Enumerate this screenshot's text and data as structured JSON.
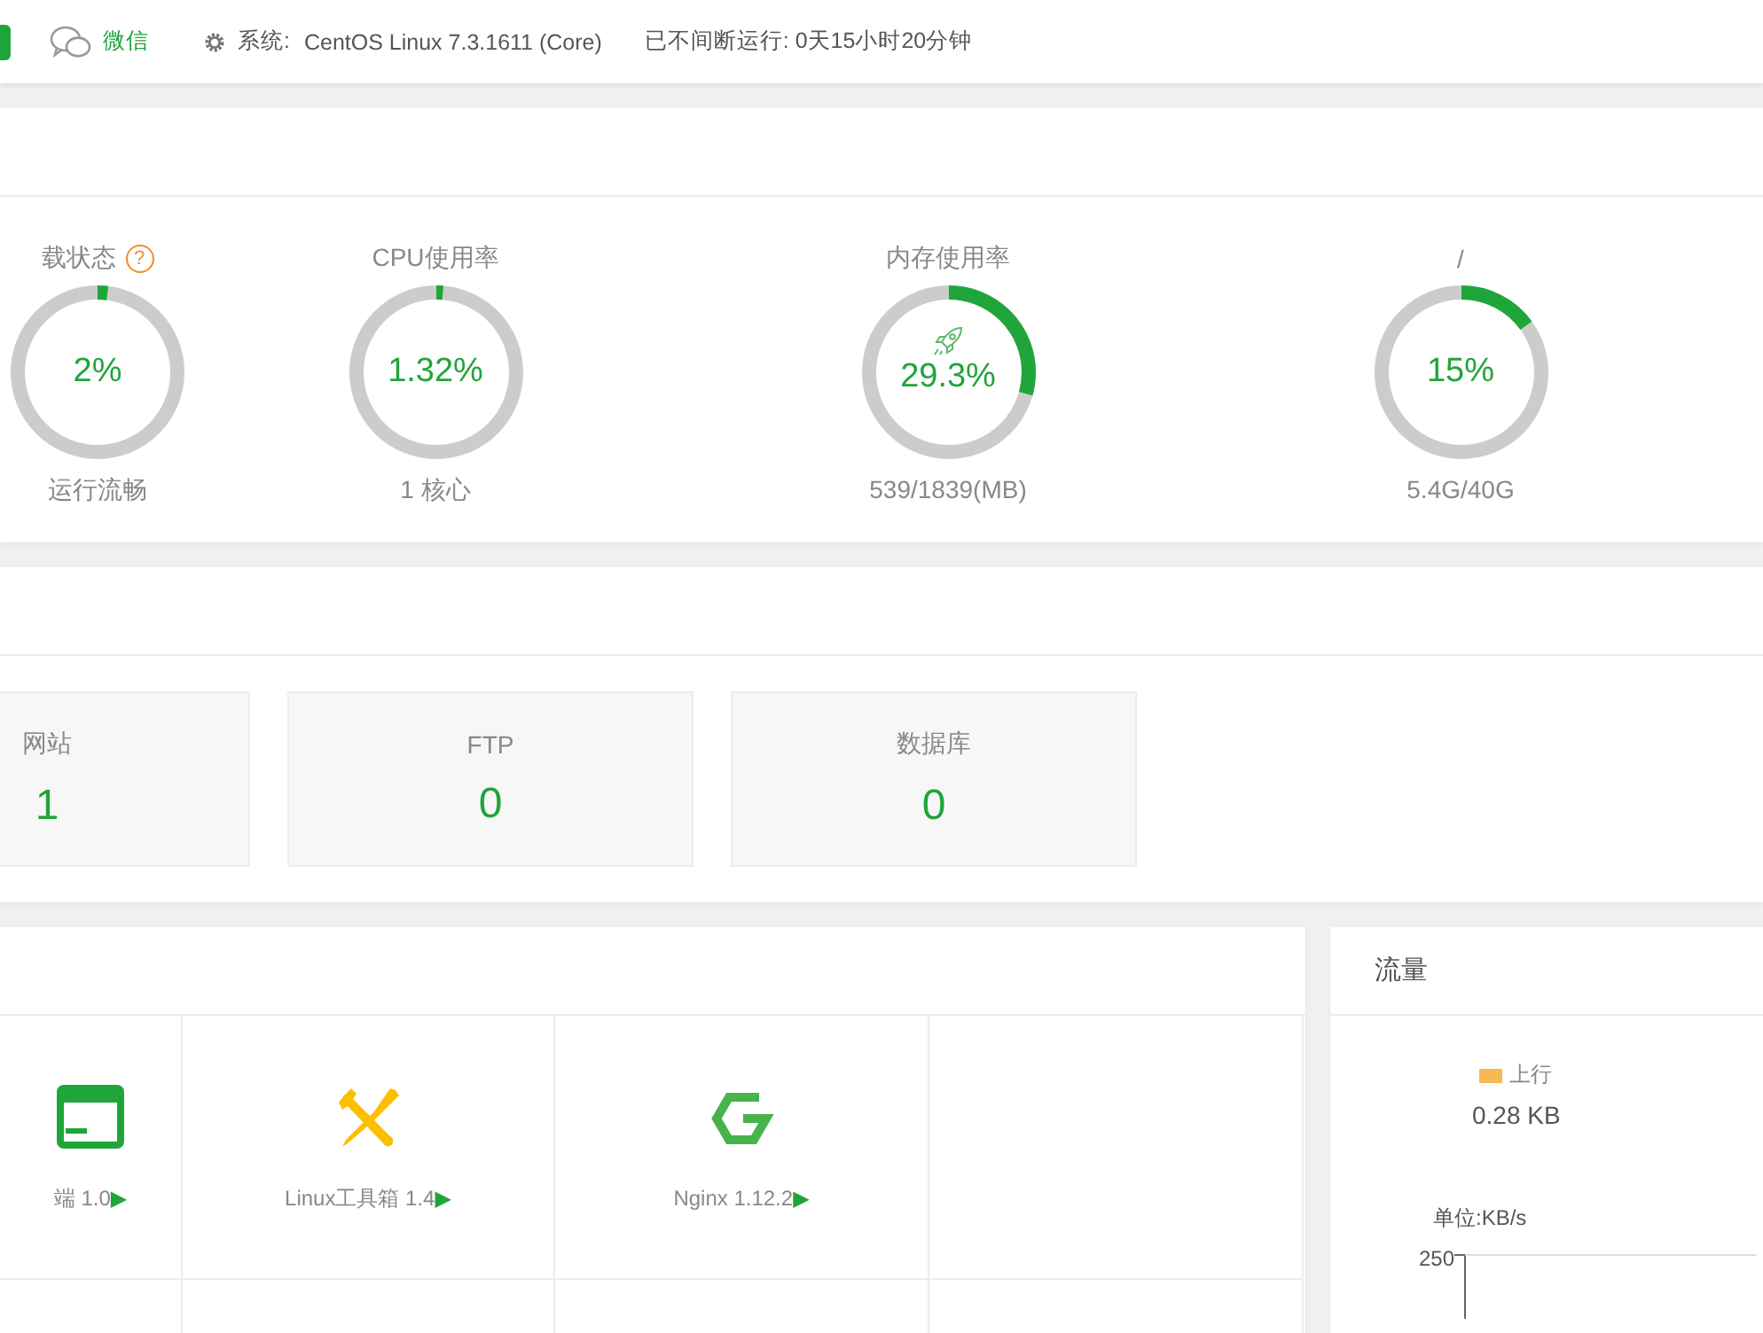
{
  "top_bar": {
    "wechat": "微信",
    "system_label": "系统:",
    "system_value": "CentOS Linux 7.3.1611 (Core)",
    "uptime": "已不间断运行: 0天15小时20分钟"
  },
  "gauges": [
    {
      "title": "载状态",
      "help": "?",
      "value": "2%",
      "caption": "运行流畅",
      "level": 0.02,
      "kind": "plain"
    },
    {
      "title": "CPU使用率",
      "value": "1.32%",
      "caption": "1 核心",
      "level": 0.0132,
      "kind": "plain"
    },
    {
      "title": "内存使用率",
      "value": "29.3%",
      "caption": "539/1839(MB)",
      "level": 0.293,
      "kind": "rocket"
    },
    {
      "title": "/",
      "value": "15%",
      "caption": "5.4G/40G",
      "level": 0.15,
      "kind": "plain"
    }
  ],
  "stats": [
    {
      "label": "网站",
      "value": "1"
    },
    {
      "label": "FTP",
      "value": "0"
    },
    {
      "label": "数据库",
      "value": "0"
    }
  ],
  "software": [
    {
      "name": "端 1.0",
      "play": "▶",
      "kind": "window"
    },
    {
      "name": "Linux工具箱 1.4",
      "play": "▶",
      "kind": "tools"
    },
    {
      "name": "Nginx 1.12.2",
      "play": "▶",
      "kind": "nginx"
    }
  ],
  "traffic": {
    "title": "流量",
    "legend": [
      {
        "label": "上行",
        "color": "#f7b851"
      }
    ],
    "amount": "0.28 KB",
    "unit": "单位:KB/s",
    "tick": "250"
  }
}
